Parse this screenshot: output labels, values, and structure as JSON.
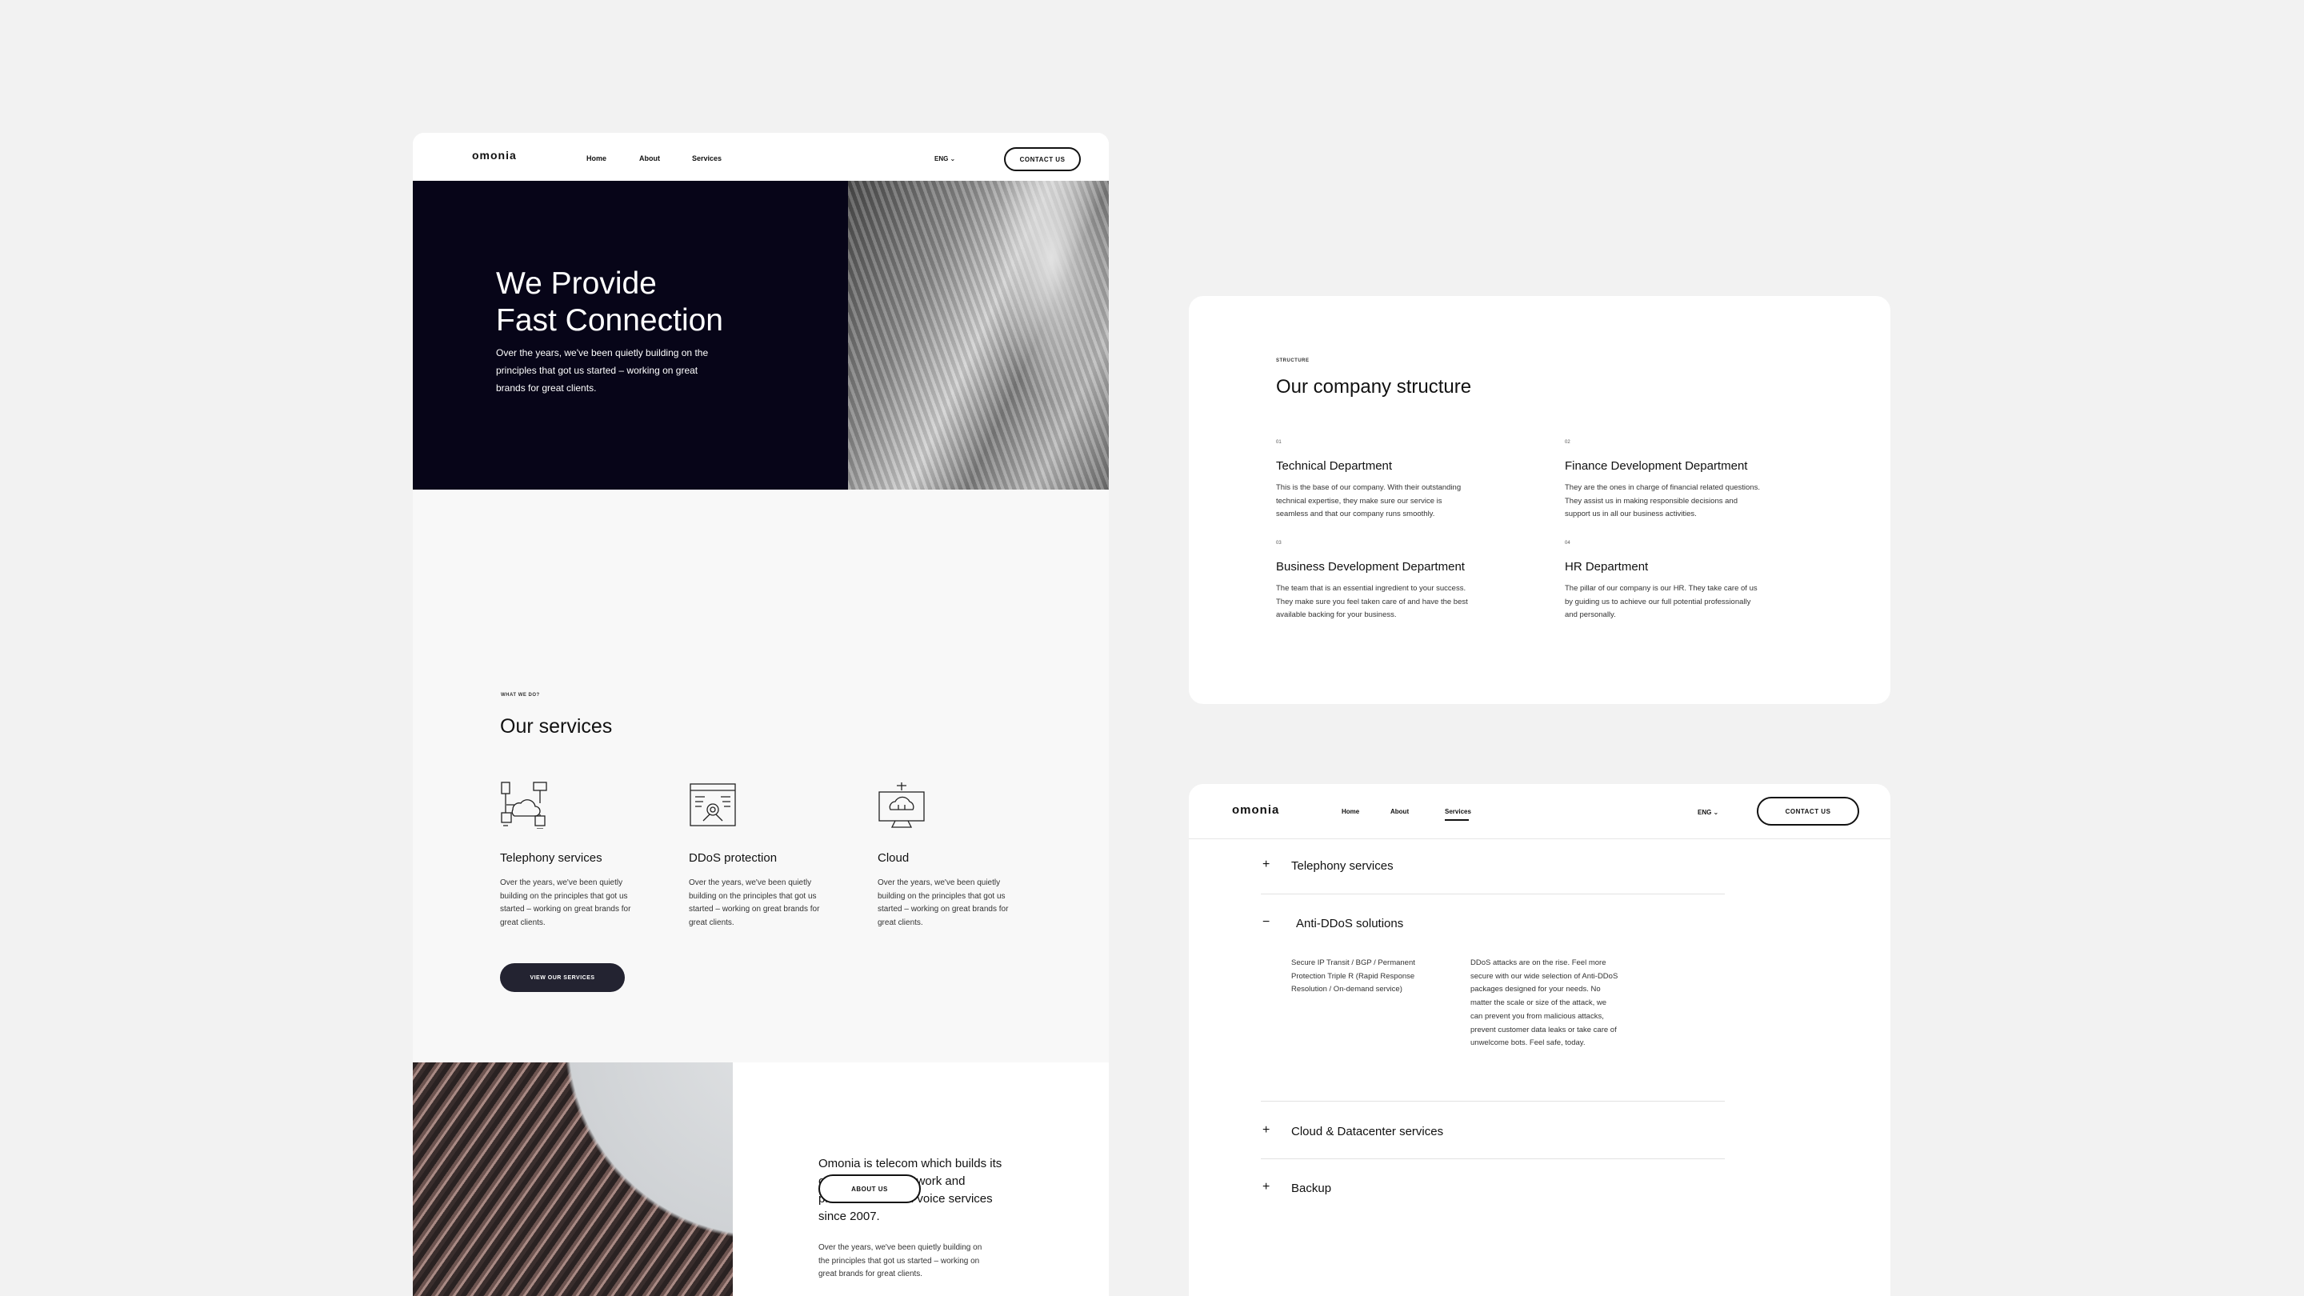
{
  "home": {
    "nav": {
      "logo": "omonia",
      "links": [
        "Home",
        "About",
        "Services"
      ],
      "lang": "ENG ⌄",
      "contact": "CONTACT US"
    },
    "hero": {
      "title_line1": "We Provide",
      "title_line2": "Fast Connection",
      "text": "Over the years, we've been quietly building on the principles that got us started – working on great brands for great clients."
    },
    "services": {
      "eyebrow": "WHAT WE DO?",
      "title": "Our services",
      "items": [
        {
          "icon": "telephony-network-icon",
          "name": "Telephony services",
          "desc": "Over the years, we've been quietly building on the principles that got us started – working on great brands for great clients."
        },
        {
          "icon": "ddos-shield-icon",
          "name": "DDoS protection",
          "desc": "Over the years, we've been quietly building on the principles that got us started – working on great brands for great clients."
        },
        {
          "icon": "cloud-monitor-icon",
          "name": "Cloud",
          "desc": "Over the years, we've been quietly building on the principles that got us started – working on great brands for great clients."
        }
      ],
      "button": "VIEW OUR SERVICES"
    },
    "about": {
      "heading": "Omonia is telecom which builds its own fibre-optic network and provides data and voice services since 2007.",
      "text": "Over the years, we've been quietly building on the principles that got us started – working on great brands for great clients.",
      "button": "ABOUT US"
    }
  },
  "structure": {
    "eyebrow": "STRUCTURE",
    "title": "Our company structure",
    "departments": [
      {
        "num": "01",
        "name": "Technical Department",
        "desc": "This is the base of our company. With their outstanding technical expertise, they make sure our service is seamless and that our company runs smoothly."
      },
      {
        "num": "02",
        "name": "Finance Development Department",
        "desc": "They are the ones in charge of financial related questions. They assist us in making responsible decisions and support us in all our business activities."
      },
      {
        "num": "03",
        "name": "Business Development Department",
        "desc": "The team that is an essential ingredient to your success. They make sure you feel taken care of and have the best available backing for your business."
      },
      {
        "num": "04",
        "name": "HR Department",
        "desc": "The pillar of our company is our HR. They take care of us by guiding us to achieve our full potential professionally and personally."
      }
    ]
  },
  "services_page": {
    "nav": {
      "logo": "omonia",
      "links": [
        "Home",
        "About",
        "Services"
      ],
      "active": "Services",
      "lang": "ENG ⌄",
      "contact": "CONTACT US"
    },
    "accordion": [
      {
        "sign": "+",
        "title": "Telephony services"
      },
      {
        "sign": "−",
        "title": "Anti-DDoS solutions",
        "left": "Secure IP Transit / BGP / Permanent Protection Triple R (Rapid Response Resolution / On-demand service)",
        "right": "DDoS attacks are on the rise. Feel more secure with our wide selection of Anti-DDoS packages designed for your needs. No matter the scale or size of the attack, we can prevent you from malicious attacks, prevent customer data leaks or take care of unwelcome bots. Feel safe, today."
      },
      {
        "sign": "+",
        "title": "Cloud & Datacenter services"
      },
      {
        "sign": "+",
        "title": "Backup"
      }
    ]
  }
}
